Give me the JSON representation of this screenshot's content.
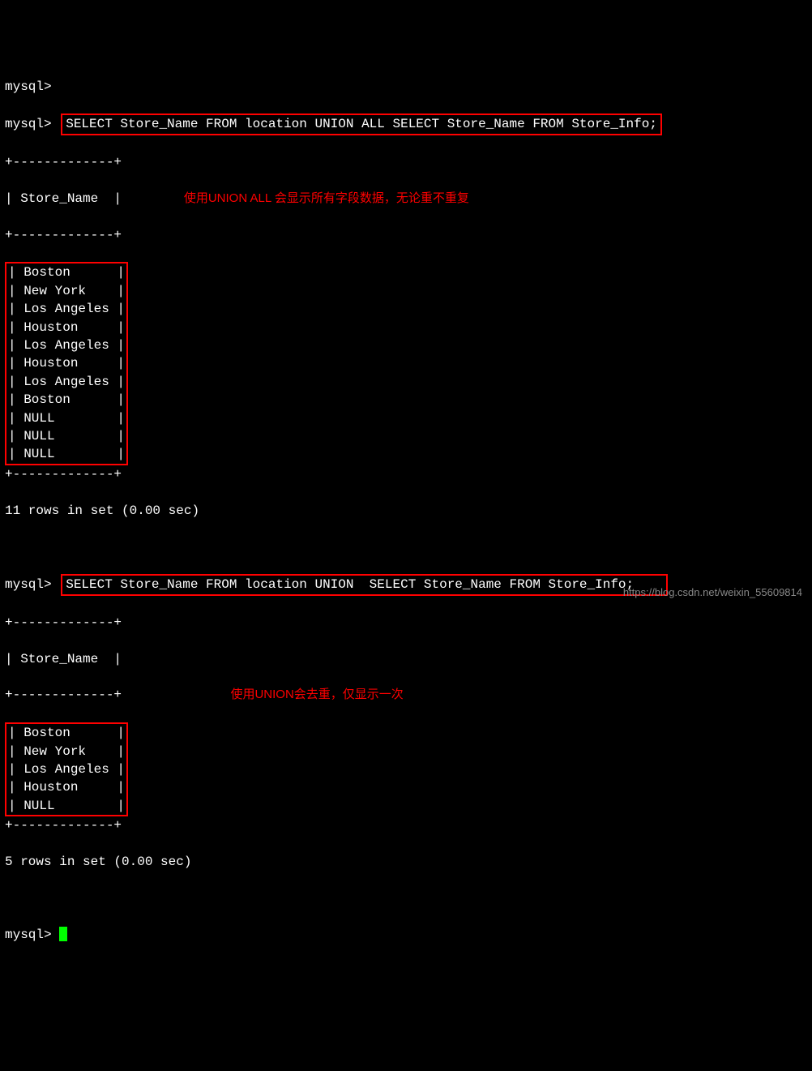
{
  "prompt": "mysql>",
  "query1": "SELECT Store_Name FROM location UNION ALL SELECT Store_Name FROM Store_Info;",
  "annotation1": "使用UNION ALL 会显示所有字段数据，无论重不重复",
  "separator1": "+-------------+",
  "header1": "| Store_Name  |",
  "result1_rows": [
    "| Boston      |",
    "| New York    |",
    "| Los Angeles |",
    "| Houston     |",
    "| Los Angeles |",
    "| Houston     |",
    "| Los Angeles |",
    "| Boston      |",
    "| NULL        |",
    "| NULL        |",
    "| NULL        |"
  ],
  "status1": "11 rows in set (0.00 sec)",
  "query2": "SELECT Store_Name FROM location UNION  SELECT Store_Name FROM Store_Info;",
  "annotation2": "使用UNION会去重，仅显示一次",
  "header2": "| Store_Name  |",
  "result2_rows": [
    "| Boston      |",
    "| New York    |",
    "| Los Angeles |",
    "| Houston     |",
    "| NULL        |"
  ],
  "status2": "5 rows in set (0.00 sec)",
  "watermark": "https://blog.csdn.net/weixin_55609814"
}
